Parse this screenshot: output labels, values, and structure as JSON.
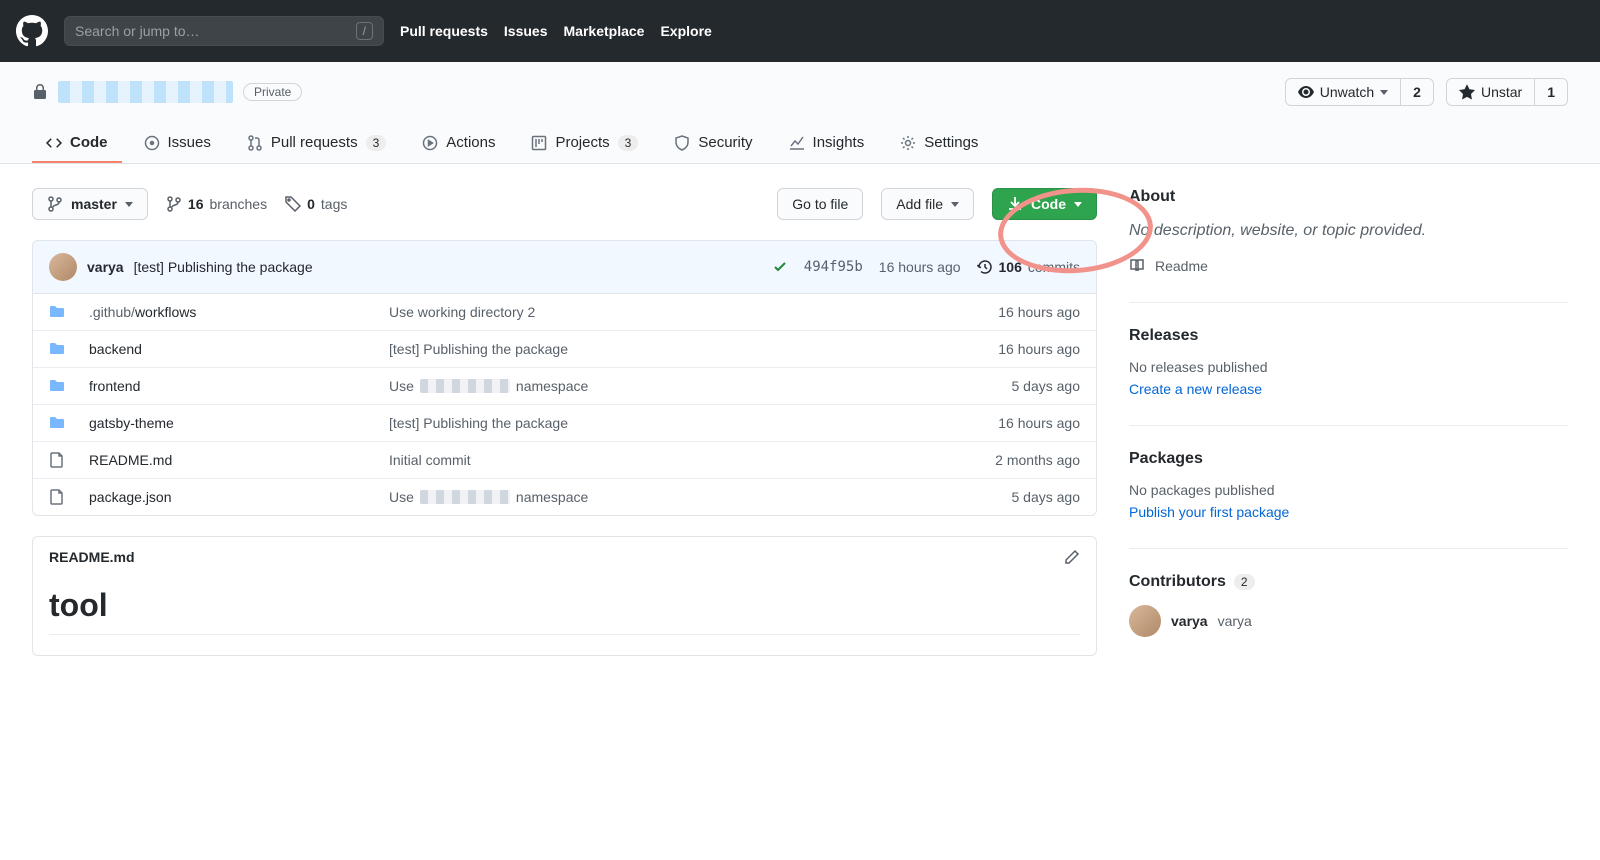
{
  "topnav": {
    "search_placeholder": "Search or jump to…",
    "slash": "/",
    "links": [
      "Pull requests",
      "Issues",
      "Marketplace",
      "Explore"
    ]
  },
  "repo": {
    "visibility": "Private",
    "unwatch": "Unwatch",
    "watch_count": "2",
    "unstar": "Unstar",
    "star_count": "1"
  },
  "tabs": {
    "code": "Code",
    "issues": "Issues",
    "pulls": "Pull requests",
    "pulls_count": "3",
    "actions": "Actions",
    "projects": "Projects",
    "projects_count": "3",
    "security": "Security",
    "insights": "Insights",
    "settings": "Settings"
  },
  "filenav": {
    "branch": "master",
    "branches_count": "16",
    "branches_label": "branches",
    "tags_count": "0",
    "tags_label": "tags",
    "go_to_file": "Go to file",
    "add_file": "Add file",
    "code_btn": "Code"
  },
  "commit": {
    "author": "varya",
    "message": "[test] Publishing the package",
    "sha": "494f95b",
    "time": "16 hours ago",
    "commits_count": "106",
    "commits_label": "commits"
  },
  "files": [
    {
      "type": "dir",
      "name_pre": ".github/",
      "name_bold": "workflows",
      "msg": "Use working directory 2",
      "redacted": false,
      "time": "16 hours ago"
    },
    {
      "type": "dir",
      "name_pre": "",
      "name_bold": "backend",
      "msg": "[test] Publishing the package",
      "redacted": false,
      "time": "16 hours ago"
    },
    {
      "type": "dir",
      "name_pre": "",
      "name_bold": "frontend",
      "msg_pre": "Use ",
      "msg_post": " namespace",
      "redacted": true,
      "time": "5 days ago"
    },
    {
      "type": "dir",
      "name_pre": "",
      "name_bold": "gatsby-theme",
      "msg": "[test] Publishing the package",
      "redacted": false,
      "time": "16 hours ago"
    },
    {
      "type": "file",
      "name_pre": "",
      "name_bold": "README.md",
      "msg": "Initial commit",
      "redacted": false,
      "time": "2 months ago"
    },
    {
      "type": "file",
      "name_pre": "",
      "name_bold": "package.json",
      "msg_pre": "Use ",
      "msg_post": " namespace",
      "redacted": true,
      "time": "5 days ago"
    }
  ],
  "readme": {
    "filename": "README.md",
    "heading": "tool"
  },
  "sidebar": {
    "about": "About",
    "desc": "No description, website, or topic provided.",
    "readme": "Readme",
    "releases": "Releases",
    "releases_none": "No releases published",
    "releases_link": "Create a new release",
    "packages": "Packages",
    "packages_none": "No packages published",
    "packages_link": "Publish your first package",
    "contributors": "Contributors",
    "contributors_count": "2",
    "contrib_name": "varya",
    "contrib_login": "varya"
  }
}
